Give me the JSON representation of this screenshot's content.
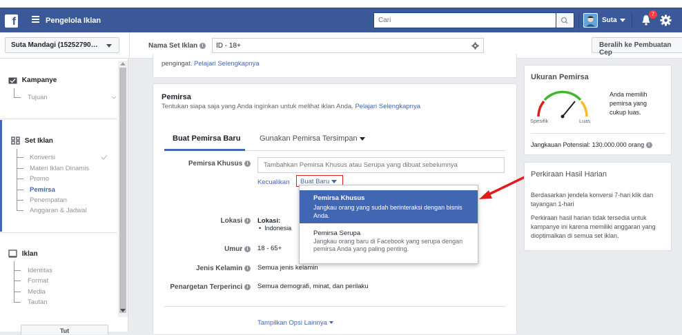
{
  "topbar": {
    "app_title": "Pengelola Iklan",
    "search_placeholder": "Cari",
    "user_name": "Suta",
    "notification_count": "7",
    "icons": [
      "facebook-logo-icon",
      "hamburger-menu-icon",
      "search-icon",
      "avatar",
      "caret-down-icon",
      "notification-bell-icon",
      "gear-icon"
    ]
  },
  "toolbar": {
    "account": "Suta Mandagi (15252790…",
    "adset_name_label": "Nama Set Iklan",
    "adset_name_value": "ID - 18+",
    "switch_button": "Beralih ke Pembuatan Cep"
  },
  "sidebar": {
    "campaign": {
      "title": "Kampanye",
      "items": [
        "Tujuan"
      ]
    },
    "adset": {
      "title": "Set Iklan",
      "items": [
        "Konversi",
        "Materi Iklan Dinamis",
        "Promo",
        "Pemirsa",
        "Penempatan",
        "Anggaran & Jadwal"
      ],
      "active_index": 3
    },
    "ad": {
      "title": "Iklan",
      "items": [
        "Identitas",
        "Format",
        "Media",
        "Tautan"
      ]
    },
    "bottom_button": "Tut"
  },
  "main": {
    "top_card_text": "pengingat.",
    "top_card_link": "Pelajari Selengkapnya",
    "audience": {
      "title": "Pemirsa",
      "desc": "Tentukan siapa saja yang Anda inginkan untuk melihat iklan Anda.",
      "desc_link": "Pelajari Selengkapnya",
      "tabs": [
        "Buat Pemirsa Baru",
        "Gunakan Pemirsa Tersimpan"
      ],
      "custom_label": "Pemirsa Khusus",
      "custom_placeholder": "Tambahkan Pemirsa Khusus atau Serupa yang dibuat sebelumnya",
      "exclude_link": "Kecualikan",
      "create_new_button": "Buat Baru",
      "location_label": "Lokasi",
      "location_heading": "Lokasi:",
      "location_value": "Indonesia",
      "age_label": "Umur",
      "age_value": "18 - 65+",
      "gender_label": "Jenis Kelamin",
      "gender_value": "Semua jenis kelamin",
      "targeting_label": "Penargetan Terperinci",
      "targeting_value": "Semua demografi, minat, dan perilaku",
      "more_options": "Tampilkan Opsi Lainnya"
    },
    "dropdown": [
      {
        "title": "Pemirsa Khusus",
        "desc": "Jangkau orang yang sudah berinteraksi dengan bisnis Anda."
      },
      {
        "title": "Pemirsa Serupa",
        "desc": "Jangkau orang baru di Facebook yang serupa dengan pemirsa Anda yang paling penting."
      }
    ]
  },
  "right_panel": {
    "size_title": "Ukuran Pemirsa",
    "gauge_left": "Spesifik",
    "gauge_right": "Luas",
    "size_desc": "Anda memilih pemirsa yang cukup luas.",
    "potential_reach": "Jangkauan Potensial: 130.000.000 orang",
    "daily_title": "Perkiraan Hasil Harian",
    "daily_p1": "Berdasarkan jendela konversi 7-hari klik dan tayangan 1-hari",
    "daily_p2": "Perkiraan hasil harian tidak tersedia untuk kampanye ini karena memiliki anggaran yang dioptimalkan di semua set iklan."
  },
  "colors": {
    "brand": "#3b5998",
    "accent": "#4267b2",
    "annotation": "#e41b1b",
    "highlight": "#4267b2"
  }
}
